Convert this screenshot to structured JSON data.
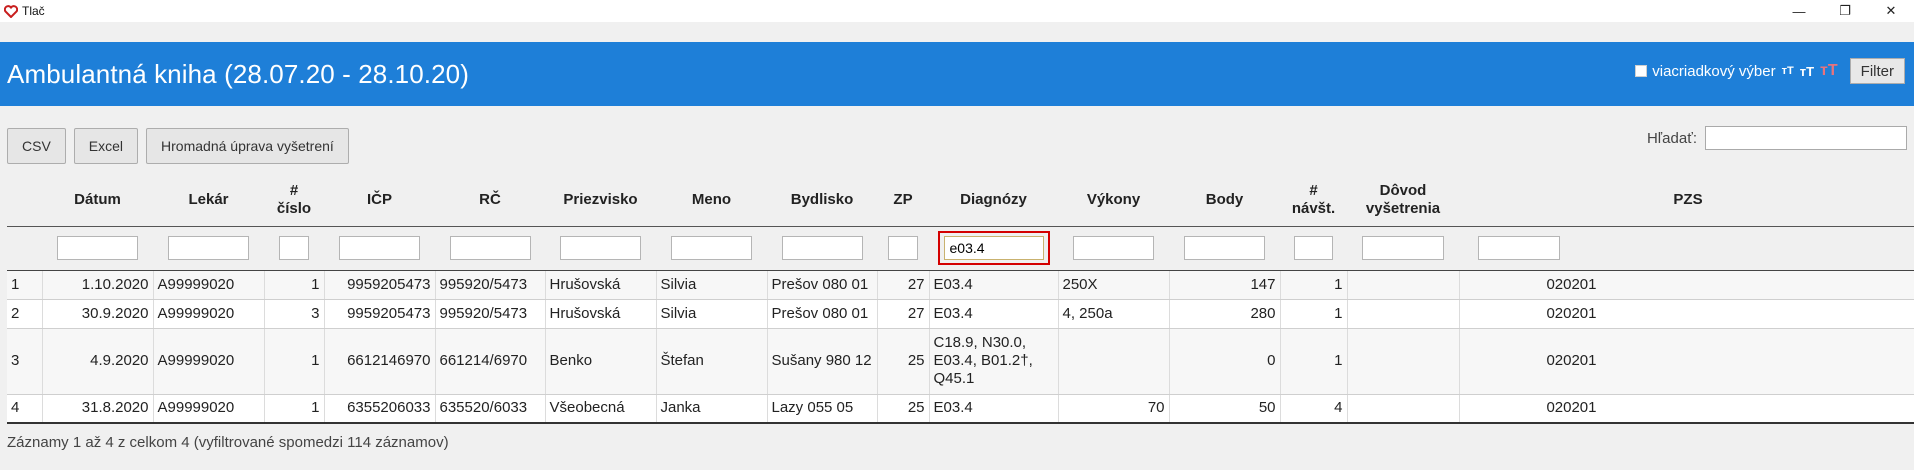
{
  "window": {
    "title": "Tlač",
    "controls": {
      "minimize": "—",
      "restore": "❐",
      "close": "✕"
    }
  },
  "header": {
    "title": "Ambulantná kniha (28.07.20 - 28.10.20)",
    "multi_select_label": "viacriadkový výber",
    "font_small": "ᴛT",
    "font_medium": "ᴛT",
    "font_large": "ᴛT",
    "filter_button": "Filter",
    "accent_color": "#1e7fd8"
  },
  "toolbar": {
    "csv_button": "CSV",
    "excel_button": "Excel",
    "bulk_edit_button": "Hromadná úprava vyšetrení"
  },
  "search": {
    "label": "Hľadať:",
    "value": ""
  },
  "table": {
    "columns": [
      {
        "line1": "",
        "line2": ""
      },
      {
        "line1": "Dátum",
        "line2": ""
      },
      {
        "line1": "Lekár",
        "line2": ""
      },
      {
        "line1": "#",
        "line2": "číslo"
      },
      {
        "line1": "IČP",
        "line2": ""
      },
      {
        "line1": "RČ",
        "line2": ""
      },
      {
        "line1": "Priezvisko",
        "line2": ""
      },
      {
        "line1": "Meno",
        "line2": ""
      },
      {
        "line1": "Bydlisko",
        "line2": ""
      },
      {
        "line1": "ZP",
        "line2": ""
      },
      {
        "line1": "Diagnózy",
        "line2": ""
      },
      {
        "line1": "Výkony",
        "line2": ""
      },
      {
        "line1": "Body",
        "line2": ""
      },
      {
        "line1": "#",
        "line2": "návšt."
      },
      {
        "line1": "Dôvod",
        "line2": "vyšetrenia"
      },
      {
        "line1": "PZS",
        "line2": ""
      }
    ],
    "filters": {
      "datum": "",
      "lekar": "",
      "cislo": "",
      "icp": "",
      "rc": "",
      "priezvisko": "",
      "meno": "",
      "bydlisko": "",
      "zp": "",
      "diagnozy": "e03.4",
      "vykony": "",
      "body": "",
      "navst": "",
      "dovod": "",
      "pzs": ""
    },
    "rows": [
      {
        "n": "1",
        "datum": "1.10.2020",
        "lekar": "A99999020",
        "cislo": "1",
        "icp": "9959205473",
        "rc": "995920/5473",
        "priezvisko": "Hrušovská",
        "meno": "Silvia",
        "bydlisko": "Prešov 080 01",
        "zp": "27",
        "diag1": "E03.4",
        "diag2": "",
        "diag3": "",
        "diag4": "",
        "vykony_l": "250X",
        "vykony_r": "",
        "body": "147",
        "navst": "1",
        "dovod": "",
        "pzs": "020201"
      },
      {
        "n": "2",
        "datum": "30.9.2020",
        "lekar": "A99999020",
        "cislo": "3",
        "icp": "9959205473",
        "rc": "995920/5473",
        "priezvisko": "Hrušovská",
        "meno": "Silvia",
        "bydlisko": "Prešov 080 01",
        "zp": "27",
        "diag1": "E03.4",
        "diag2": "",
        "diag3": "",
        "diag4": "",
        "vykony_l": "4, 250a",
        "vykony_r": "",
        "body": "280",
        "navst": "1",
        "dovod": "",
        "pzs": "020201"
      },
      {
        "n": "3",
        "datum": "4.9.2020",
        "lekar": "A99999020",
        "cislo": "1",
        "icp": "6612146970",
        "rc": "661214/6970",
        "priezvisko": "Benko",
        "meno": "Štefan",
        "bydlisko": "Sušany 980 12",
        "zp": "25",
        "diag1": "C18.9, N30.0,",
        "diag2": "E03.4, B01.2†,",
        "diag3": "Q45.1",
        "diag4": "",
        "vykony_l": "",
        "vykony_r": "",
        "body": "0",
        "navst": "1",
        "dovod": "",
        "pzs": "020201"
      },
      {
        "n": "4",
        "datum": "31.8.2020",
        "lekar": "A99999020",
        "cislo": "1",
        "icp": "6355206033",
        "rc": "635520/6033",
        "priezvisko": "Všeobecná",
        "meno": "Janka",
        "bydlisko": "Lazy 055 05",
        "zp": "25",
        "diag1": "E03.4",
        "diag2": "",
        "diag3": "",
        "diag4": "",
        "vykony_l": "",
        "vykony_r": "70",
        "body": "50",
        "navst": "4",
        "dovod": "",
        "pzs": "020201"
      }
    ]
  },
  "info": "Záznamy 1 až 4 z celkom 4 (vyfiltrované spomedzi 114 záznamov)"
}
